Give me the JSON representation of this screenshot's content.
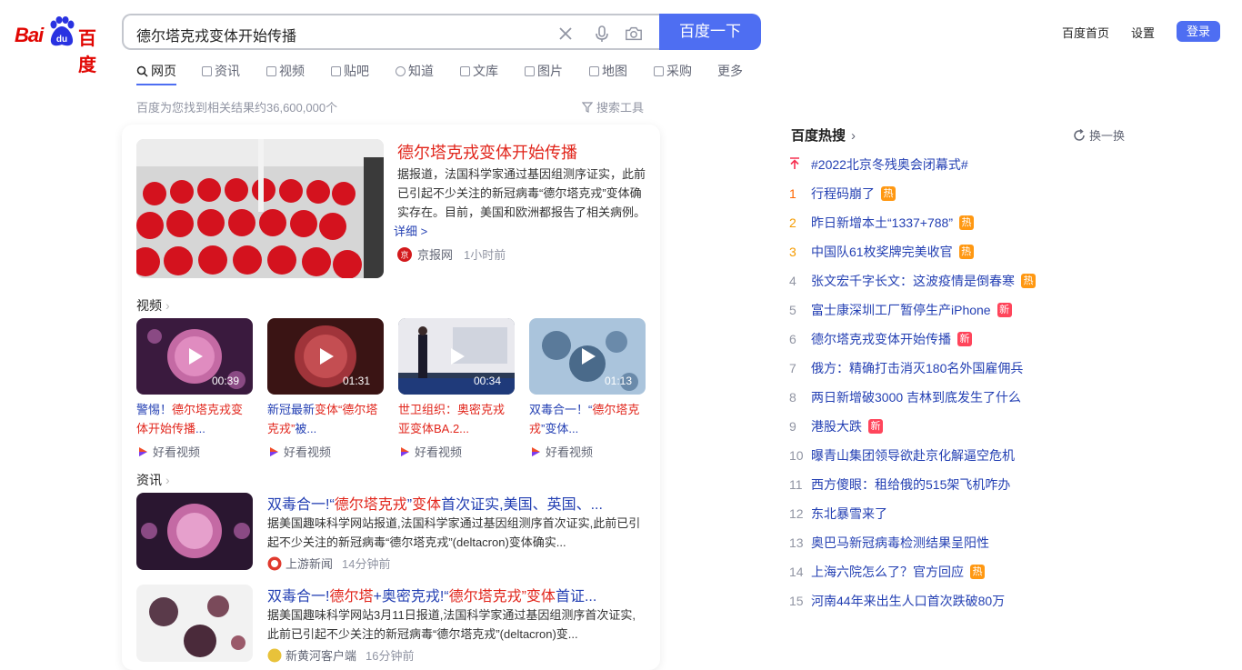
{
  "header": {
    "logo_text_latin": "Bai",
    "logo_text_paw": "du",
    "logo_text_cn": "百度",
    "search_value": "德尔塔克戎变体开始传播",
    "search_button": "百度一下",
    "links": [
      "百度首页",
      "设置"
    ],
    "login": "登录"
  },
  "tabs": [
    "网页",
    "资讯",
    "视频",
    "贴吧",
    "知道",
    "文库",
    "图片",
    "地图",
    "采购",
    "更多"
  ],
  "result_count": "百度为您找到相关结果约36,600,000个",
  "search_tools": "搜索工具",
  "top_result": {
    "title": "德尔塔克戎变体开始传播",
    "desc": "据报道，法国科学家通过基因组测序证实，此前已引起不少关注的新冠病毒“德尔塔克戎”变体确实存在。目前，美国和欧洲都报告了相关病例。",
    "more": "详细 >",
    "source": "京报网",
    "time": "1小时前"
  },
  "video_section": "视频",
  "videos": [
    {
      "duration": "00:39",
      "title_plain": "警惕！",
      "title_em": "德尔塔克戎变体开始传播",
      "title_tail": "...",
      "source": "好看视频"
    },
    {
      "duration": "01:31",
      "title_plain": "新冠最新",
      "title_em": "变体“德尔塔克戎”",
      "title_tail": "被...",
      "source": "好看视频"
    },
    {
      "duration": "00:34",
      "title_plain": "世卫组织：奥密克戎亚变体BA.2...",
      "title_em": "",
      "title_tail": "",
      "source": "好看视频"
    },
    {
      "duration": "01:13",
      "title_plain": "双毒合一！“",
      "title_em": "德尔塔克戎",
      "title_tail": "”变体...",
      "source": "好看视频"
    }
  ],
  "news_section": "资讯",
  "news": [
    {
      "t1": "双毒合一!“",
      "t2": "德尔塔克戎",
      "t3": "”",
      "t4": "变体",
      "t5": "首次证实,美国、英国、...",
      "desc": "据美国趣味科学网站报道,法国科学家通过基因组测序首次证实,此前已引起不少关注的新冠病毒“德尔塔克戎”(deltacron)变体确实...",
      "source": "上游新闻",
      "time": "14分钟前"
    },
    {
      "t1": "双毒合一!",
      "t2": "德尔塔",
      "t3": "+奥密克戎!“",
      "t4": "德尔塔克戎”变体",
      "t5": "首证...",
      "desc": "据美国趣味科学网站3月11日报道,法国科学家通过基因组测序首次证实,此前已引起不少关注的新冠病毒“德尔塔克戎”(deltacron)变...",
      "source": "新黄河客户端",
      "time": "16分钟前"
    }
  ],
  "hot": {
    "title": "百度热搜",
    "refresh": "换一换",
    "pinned": "#2022北京冬残奥会闭幕式#",
    "items": [
      {
        "rank": "1",
        "text": "行程码崩了",
        "badge": "热"
      },
      {
        "rank": "2",
        "text": "昨日新增本土“1337+788”",
        "badge": "热"
      },
      {
        "rank": "3",
        "text": "中国队61枚奖牌完美收官",
        "badge": "热"
      },
      {
        "rank": "4",
        "text": "张文宏千字长文：这波疫情是倒春寒",
        "badge": "热"
      },
      {
        "rank": "5",
        "text": "富士康深圳工厂暂停生产iPhone",
        "badge": "新"
      },
      {
        "rank": "6",
        "text": "德尔塔克戎变体开始传播",
        "badge": "新"
      },
      {
        "rank": "7",
        "text": "俄方：精确打击消灭180名外国雇佣兵",
        "badge": ""
      },
      {
        "rank": "8",
        "text": "两日新增破3000 吉林到底发生了什么",
        "badge": ""
      },
      {
        "rank": "9",
        "text": "港股大跌",
        "badge": "新"
      },
      {
        "rank": "10",
        "text": "曝青山集团领导欲赴京化解逼空危机",
        "badge": ""
      },
      {
        "rank": "11",
        "text": "西方傻眼：租给俄的515架飞机咋办",
        "badge": ""
      },
      {
        "rank": "12",
        "text": "东北暴雪来了",
        "badge": ""
      },
      {
        "rank": "13",
        "text": "奥巴马新冠病毒检测结果呈阳性",
        "badge": ""
      },
      {
        "rank": "14",
        "text": "上海六院怎么了？官方回应",
        "badge": "热"
      },
      {
        "rank": "15",
        "text": "河南44年来出生人口首次跌破80万",
        "badge": ""
      }
    ]
  },
  "colors": {
    "brand_blue": "#4e6ef2",
    "link": "#2440b3",
    "highlight": "#e1251b",
    "logo_red": "#e10602"
  }
}
